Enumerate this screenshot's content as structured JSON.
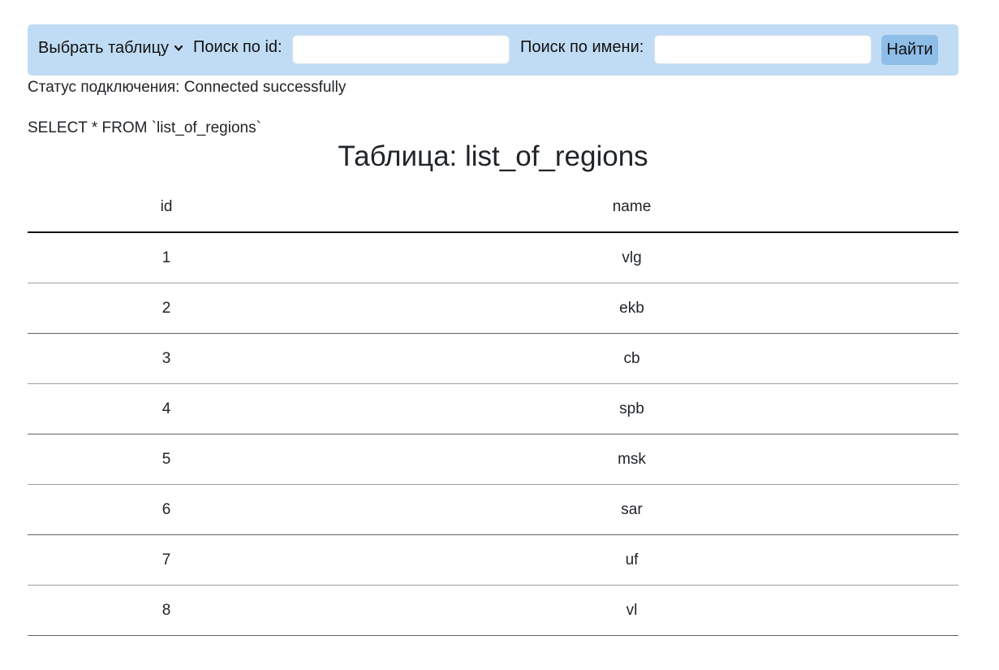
{
  "toolbar": {
    "select_label": "Выбрать таблицу",
    "search_id_label": "Поиск по id:",
    "search_id_value": "",
    "search_name_label": "Поиск по имени:",
    "search_name_value": "",
    "find_button": "Найти",
    "background_color": "#c0dcf4",
    "button_color": "#8ebde8"
  },
  "status": "Статус подключения: Connected successfully",
  "query": "SELECT * FROM `list_of_regions`",
  "table": {
    "title": "Таблица: list_of_regions",
    "columns": [
      "id",
      "name"
    ],
    "rows": [
      [
        "1",
        "vlg"
      ],
      [
        "2",
        "ekb"
      ],
      [
        "3",
        "cb"
      ],
      [
        "4",
        "spb"
      ],
      [
        "5",
        "msk"
      ],
      [
        "6",
        "sar"
      ],
      [
        "7",
        "uf"
      ],
      [
        "8",
        "vl"
      ]
    ]
  }
}
